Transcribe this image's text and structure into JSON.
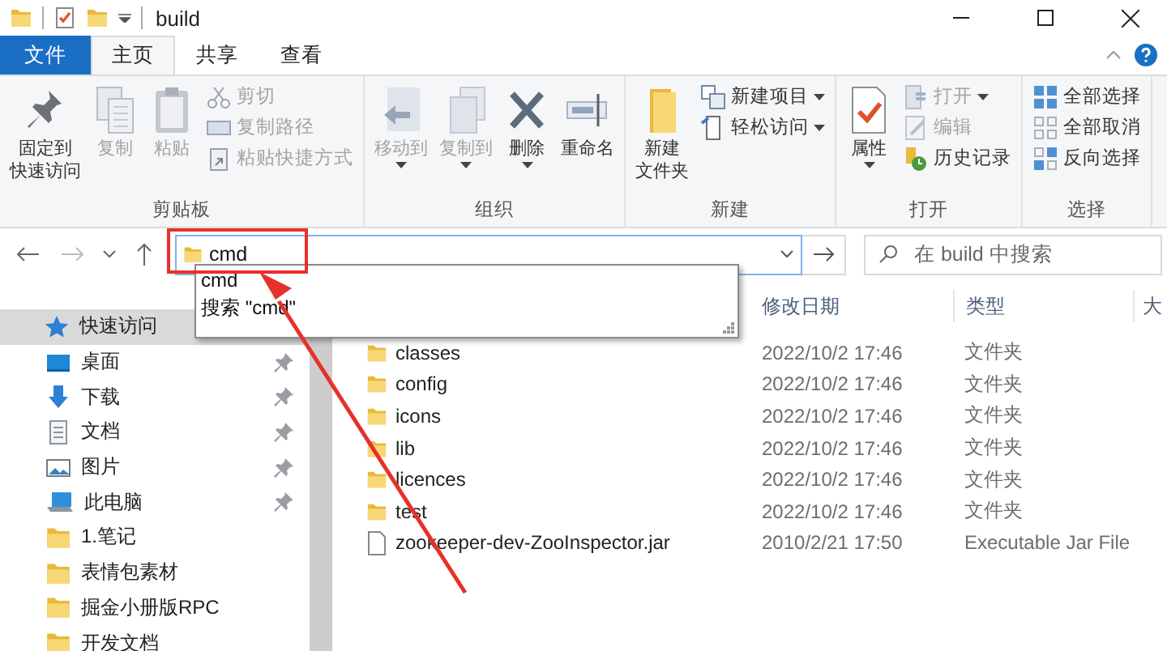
{
  "window": {
    "title": "build"
  },
  "ribbon_tabs": [
    {
      "label": "文件",
      "kind": "file",
      "selected": false
    },
    {
      "label": "主页",
      "kind": "tab",
      "selected": true
    },
    {
      "label": "共享",
      "kind": "tab",
      "selected": false
    },
    {
      "label": "查看",
      "kind": "tab",
      "selected": false
    }
  ],
  "ribbon_groups": [
    {
      "label": "剪贴板",
      "commands": [
        {
          "lines": [
            "固定到",
            "快速访问"
          ],
          "kind": "large",
          "disabled": false,
          "dropdown": false
        },
        {
          "label": "复制",
          "kind": "large",
          "disabled": true,
          "dropdown": false
        },
        {
          "label": "粘贴",
          "kind": "large",
          "disabled": true,
          "dropdown": false
        },
        {
          "label": "剪切",
          "kind": "small",
          "disabled": true,
          "dropdown": false
        },
        {
          "label": "复制路径",
          "kind": "small",
          "disabled": true,
          "dropdown": false
        },
        {
          "label": "粘贴快捷方式",
          "kind": "small",
          "disabled": true,
          "dropdown": false
        }
      ]
    },
    {
      "label": "组织",
      "commands": [
        {
          "label": "移动到",
          "kind": "large",
          "disabled": true,
          "dropdown": true
        },
        {
          "label": "复制到",
          "kind": "large",
          "disabled": true,
          "dropdown": true
        },
        {
          "label": "删除",
          "kind": "large",
          "disabled": false,
          "dropdown": true
        },
        {
          "label": "重命名",
          "kind": "large",
          "disabled": false,
          "dropdown": false
        }
      ]
    },
    {
      "label": "新建",
      "commands": [
        {
          "lines": [
            "新建",
            "文件夹"
          ],
          "kind": "large",
          "disabled": false,
          "dropdown": false
        },
        {
          "label": "新建项目",
          "kind": "small",
          "disabled": false,
          "dropdown": true
        },
        {
          "label": "轻松访问",
          "kind": "small",
          "disabled": false,
          "dropdown": true
        }
      ]
    },
    {
      "label": "打开",
      "commands": [
        {
          "label": "属性",
          "kind": "large",
          "disabled": false,
          "dropdown": true
        },
        {
          "label": "打开",
          "kind": "small",
          "disabled": true,
          "dropdown": true
        },
        {
          "label": "编辑",
          "kind": "small",
          "disabled": true,
          "dropdown": false
        },
        {
          "label": "历史记录",
          "kind": "small",
          "disabled": false,
          "dropdown": false
        }
      ]
    },
    {
      "label": "选择",
      "commands": [
        {
          "label": "全部选择",
          "kind": "small",
          "disabled": false,
          "dropdown": false
        },
        {
          "label": "全部取消",
          "kind": "small",
          "disabled": false,
          "dropdown": false
        },
        {
          "label": "反向选择",
          "kind": "small",
          "disabled": false,
          "dropdown": false
        }
      ]
    }
  ],
  "address_bar": {
    "value": "cmd",
    "suggestions": [
      "cmd",
      "搜索 \"cmd\""
    ]
  },
  "search": {
    "placeholder": "在 build 中搜索"
  },
  "nav_pane": {
    "items": [
      {
        "label": "快速访问",
        "kind": "star",
        "selected": true,
        "pinned": false
      },
      {
        "label": "桌面",
        "kind": "desktop",
        "selected": false,
        "pinned": true
      },
      {
        "label": "下载",
        "kind": "download",
        "selected": false,
        "pinned": true
      },
      {
        "label": "文档",
        "kind": "document",
        "selected": false,
        "pinned": true
      },
      {
        "label": "图片",
        "kind": "picture",
        "selected": false,
        "pinned": true
      },
      {
        "label": "此电脑",
        "kind": "computer",
        "selected": false,
        "pinned": true
      },
      {
        "label": "1.笔记",
        "kind": "folder",
        "selected": false,
        "pinned": false
      },
      {
        "label": "表情包素材",
        "kind": "folder",
        "selected": false,
        "pinned": false
      },
      {
        "label": "掘金小册版RPC",
        "kind": "folder",
        "selected": false,
        "pinned": false
      },
      {
        "label": "开发文档",
        "kind": "folder",
        "selected": false,
        "pinned": false
      }
    ]
  },
  "file_list": {
    "columns": [
      "修改日期",
      "类型",
      "大"
    ],
    "rows": [
      {
        "name": "classes",
        "modified": "2022/10/2 17:46",
        "type": "文件夹",
        "kind": "folder"
      },
      {
        "name": "config",
        "modified": "2022/10/2 17:46",
        "type": "文件夹",
        "kind": "folder"
      },
      {
        "name": "icons",
        "modified": "2022/10/2 17:46",
        "type": "文件夹",
        "kind": "folder"
      },
      {
        "name": "lib",
        "modified": "2022/10/2 17:46",
        "type": "文件夹",
        "kind": "folder"
      },
      {
        "name": "licences",
        "modified": "2022/10/2 17:46",
        "type": "文件夹",
        "kind": "folder"
      },
      {
        "name": "test",
        "modified": "2022/10/2 17:46",
        "type": "文件夹",
        "kind": "folder"
      },
      {
        "name": "zookeeper-dev-ZooInspector.jar",
        "modified": "2010/2/21 17:50",
        "type": "Executable Jar File",
        "kind": "file"
      }
    ]
  }
}
